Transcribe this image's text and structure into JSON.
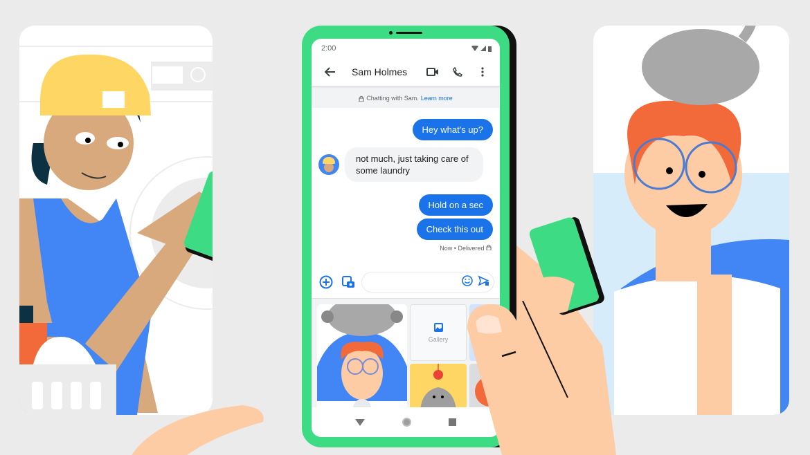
{
  "status_bar": {
    "time": "2:00",
    "icons": [
      "wifi-icon",
      "signal-icon",
      "battery-icon"
    ]
  },
  "app_bar": {
    "back_icon": "arrow-back-icon",
    "contact_name": "Sam Holmes",
    "actions": [
      "video-call-icon",
      "phone-call-icon",
      "more-vert-icon"
    ]
  },
  "info_banner": {
    "icon": "lock-icon",
    "text": "Chatting with Sam.",
    "link": "Learn more"
  },
  "messages": [
    {
      "direction": "outgoing",
      "text": "Hey what's up?"
    },
    {
      "direction": "incoming",
      "text": "not much, just taking care of some laundry"
    },
    {
      "direction": "outgoing",
      "text": "Hold on a sec"
    },
    {
      "direction": "outgoing",
      "text": "Check this out"
    }
  ],
  "delivery_status": "Now • Delivered",
  "compose": {
    "add_icon": "add-circle-icon",
    "media_icon": "gallery-camera-icon",
    "emoji_icon": "emoji-icon",
    "send_icon": "send-icon",
    "placeholder": ""
  },
  "media_tray": {
    "gallery_label": "Gallery"
  },
  "nav_bar": [
    "back",
    "home",
    "recents"
  ],
  "colors": {
    "phone_frame": "#3ddc84",
    "accent": "#1a73e8",
    "incoming_bubble": "#f1f3f4",
    "background": "#ebebeb"
  }
}
